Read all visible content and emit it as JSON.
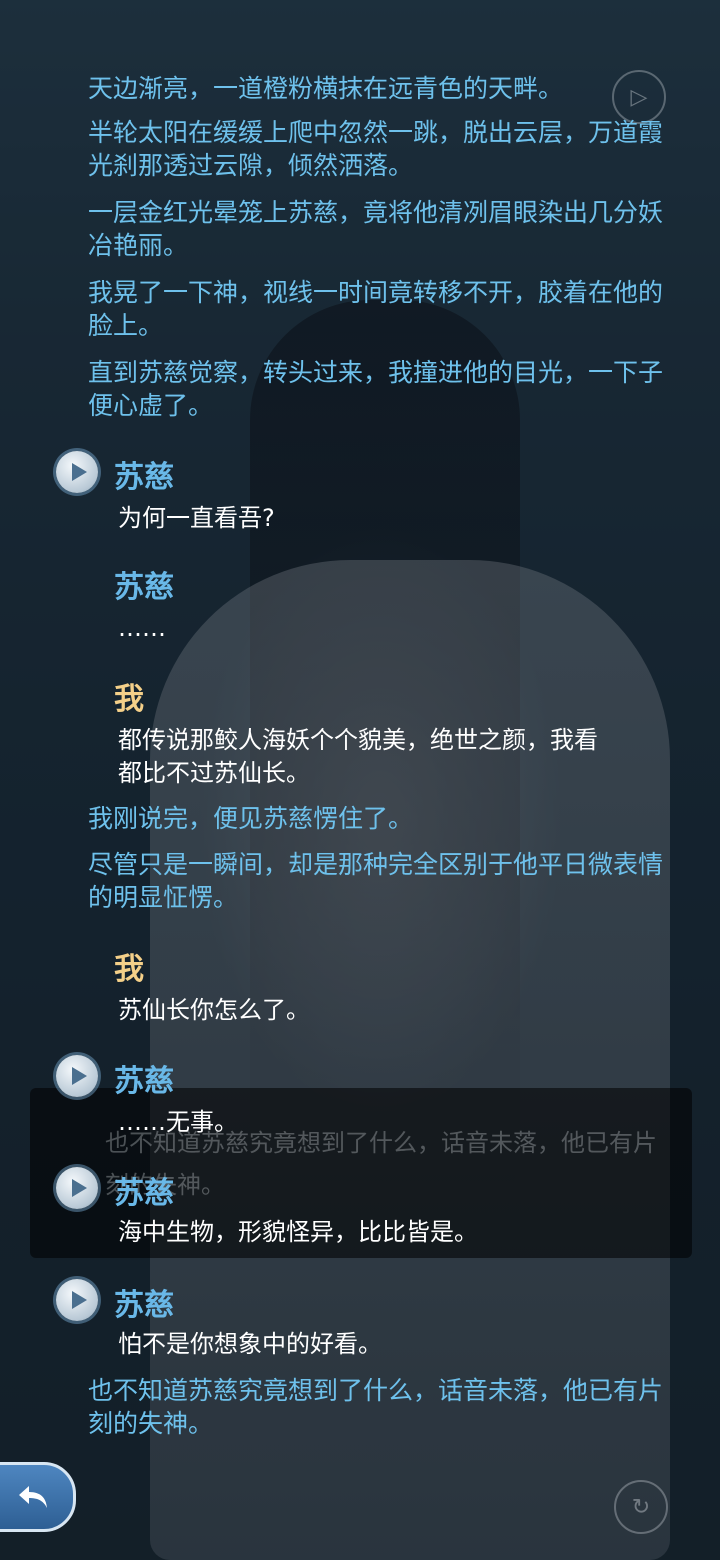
{
  "narration": [
    "天边渐亮，一道橙粉横抹在远青色的天畔。",
    "半轮太阳在缓缓上爬中忽然一跳，脱出云层，万道霞光刹那透过云隙，倾然洒落。",
    "一层金红光晕笼上苏慈，竟将他清冽眉眼染出几分妖冶艳丽。",
    "我晃了一下神，视线一时间竟转移不开，胶着在他的脸上。",
    "直到苏慈觉察，转头过来，我撞进他的目光，一下子便心虚了。"
  ],
  "dialogue": [
    {
      "speaker": "苏慈",
      "text": "为何一直看吾?",
      "voice": true,
      "color": "#69b8e8"
    },
    {
      "speaker": "苏慈",
      "text": "……",
      "voice": false,
      "color": "#69b8e8"
    },
    {
      "speaker": "我",
      "text": "都传说那鲛人海妖个个貌美，绝世之颜，我看都比不过苏仙长。",
      "voice": false,
      "color": "#f4d089"
    }
  ],
  "narration2": [
    "我刚说完，便见苏慈愣住了。",
    "尽管只是一瞬间，却是那种完全区别于他平日微表情的明显怔愣。"
  ],
  "dialogue2": [
    {
      "speaker": "我",
      "text": "苏仙长你怎么了。",
      "voice": false,
      "color": "#f4d089"
    },
    {
      "speaker": "苏慈",
      "text": "……无事。",
      "voice": true,
      "color": "#69b8e8"
    },
    {
      "speaker": "苏慈",
      "text": "海中生物，形貌怪异，比比皆是。",
      "voice": true,
      "color": "#69b8e8"
    },
    {
      "speaker": "苏慈",
      "text": "怕不是你想象中的好看。",
      "voice": true,
      "color": "#69b8e8"
    }
  ],
  "narration3": "也不知道苏慈究竟想到了什么，话音未落，他已有片刻的失神。",
  "ghost_text": "也不知道苏慈究竟想到了什么，话音未落，他已有片刻的失神。",
  "icons": {
    "back": "back-arrow-icon",
    "play": "play-voice-icon",
    "auto": "auto-play-icon",
    "replay": "replay-icon"
  }
}
